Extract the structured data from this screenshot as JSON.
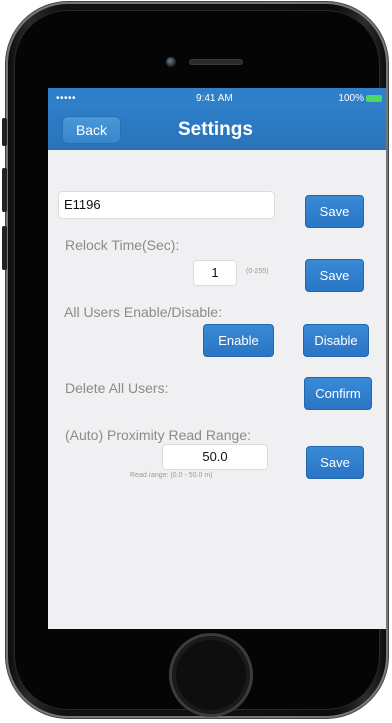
{
  "status_bar": {
    "signal": "••••• ",
    "time": "9:41 AM",
    "battery": "100%"
  },
  "nav": {
    "back_label": "Back",
    "title": "Settings"
  },
  "device_name": {
    "value": "E1196",
    "save_label": "Save"
  },
  "relock": {
    "label": "Relock Time(Sec):",
    "value": "1",
    "range_hint": "(0-255)",
    "save_label": "Save"
  },
  "users_toggle": {
    "label": "All Users Enable/Disable:",
    "enable_label": "Enable",
    "disable_label": "Disable"
  },
  "delete_users": {
    "label": "Delete All Users:",
    "confirm_label": "Confirm"
  },
  "proximity": {
    "label": "(Auto) Proximity Read Range:",
    "value": "50.0",
    "range_hint": "Read range: (0.0 - 50.0 m)",
    "save_label": "Save"
  },
  "colors": {
    "accent": "#2f7fc9",
    "screen_bg": "#f0f0f3"
  }
}
